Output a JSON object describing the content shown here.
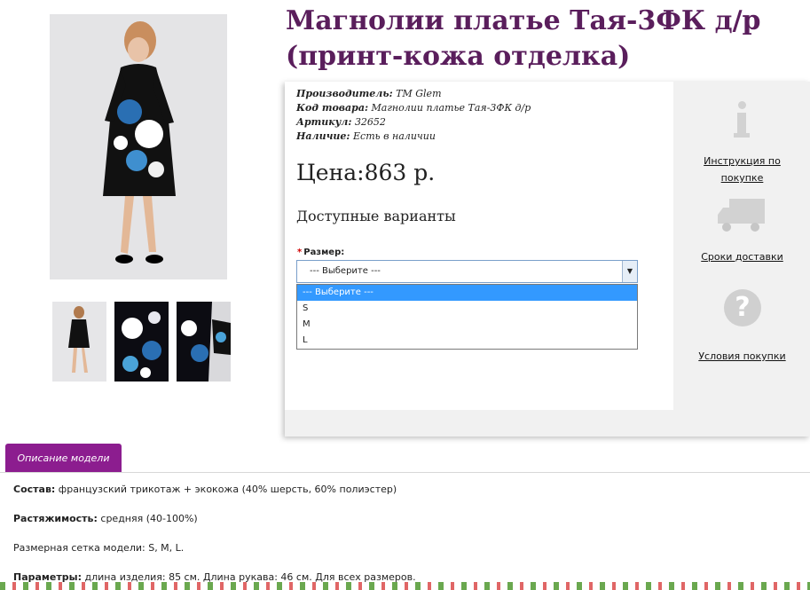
{
  "product": {
    "title": "Магнолии платье Тая-3ФК д/р (принт-кожа отделка)",
    "meta": [
      {
        "key": "Производитель:",
        "value": "TM Glem"
      },
      {
        "key": "Код товара:",
        "value": "Магнолии платье Тая-3ФК д/р"
      },
      {
        "key": "Артикул:",
        "value": "32652"
      },
      {
        "key": "Наличие:",
        "value": "Есть в наличии"
      }
    ],
    "price": "Цена:863 р.",
    "variants_title": "Доступные варианты",
    "size_label": "Размер:",
    "size_required_mark": "*",
    "size_selected": "--- Выберите ---",
    "size_options": [
      "--- Выберите ---",
      "S",
      "M",
      "L"
    ]
  },
  "side": {
    "instructions_label": "Инструкция по покупке",
    "delivery_label": "Сроки доставки",
    "terms_label": "Условия покупки",
    "help_glyph": "?"
  },
  "tab": {
    "label": "Описание модели"
  },
  "description": [
    {
      "key": "Состав:",
      "value": " французский трикотаж + экокожа (40% шерсть, 60% полиэстер)"
    },
    {
      "key": "Растяжимость:",
      "value": " средняя (40-100%)"
    },
    {
      "key": "",
      "value": "Размерная сетка модели: S, M, L."
    },
    {
      "key": "Параметры:",
      "value": " длина изделия: 85 см. Длина рукава: 46 см. Для всех размеров."
    }
  ],
  "colors": {
    "title": "#5a1e5c",
    "tab": "#8c1d8f",
    "selected_option": "#3399ff",
    "dress_print": "#2a6fb3"
  }
}
